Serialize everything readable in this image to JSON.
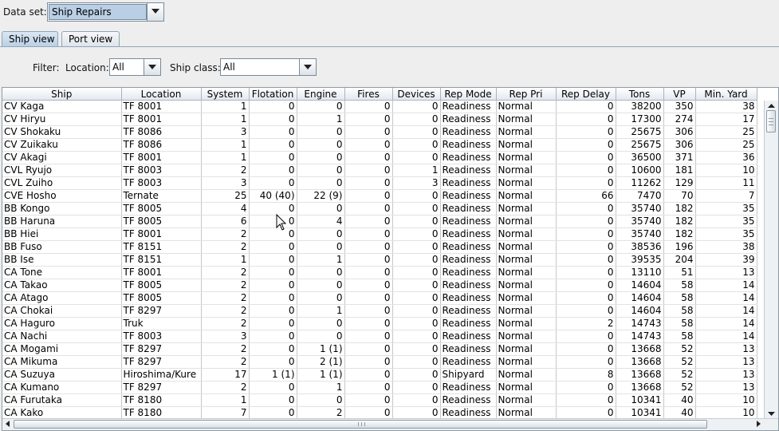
{
  "dataset": {
    "label": "Data set:",
    "value": "Ship Repairs"
  },
  "tabs": [
    {
      "label": "Ship view"
    },
    {
      "label": "Port view"
    }
  ],
  "filter": {
    "label": "Filter:",
    "location_label": "Location:",
    "location_value": "All",
    "shipclass_label": "Ship class:",
    "shipclass_value": "All"
  },
  "table": {
    "columns": [
      "Ship",
      "Location",
      "System",
      "Flotation",
      "Engine",
      "Fires",
      "Devices",
      "Rep Mode",
      "Rep Pri",
      "Rep Delay",
      "Tons",
      "VP",
      "Min. Yard"
    ],
    "rows": [
      [
        "CV Kaga",
        "TF 8001",
        "1",
        "0",
        "0",
        "0",
        "0",
        "Readiness",
        "Normal",
        "0",
        "38200",
        "350",
        "38"
      ],
      [
        "CV Hiryu",
        "TF 8001",
        "1",
        "0",
        "1",
        "0",
        "0",
        "Readiness",
        "Normal",
        "0",
        "17300",
        "274",
        "17"
      ],
      [
        "CV Shokaku",
        "TF 8086",
        "3",
        "0",
        "0",
        "0",
        "0",
        "Readiness",
        "Normal",
        "0",
        "25675",
        "306",
        "25"
      ],
      [
        "CV Zuikaku",
        "TF 8086",
        "1",
        "0",
        "0",
        "0",
        "0",
        "Readiness",
        "Normal",
        "0",
        "25675",
        "306",
        "25"
      ],
      [
        "CV Akagi",
        "TF 8001",
        "1",
        "0",
        "0",
        "0",
        "0",
        "Readiness",
        "Normal",
        "0",
        "36500",
        "371",
        "36"
      ],
      [
        "CVL Ryujo",
        "TF 8003",
        "2",
        "0",
        "0",
        "0",
        "1",
        "Readiness",
        "Normal",
        "0",
        "10600",
        "181",
        "10"
      ],
      [
        "CVL Zuiho",
        "TF 8003",
        "3",
        "0",
        "0",
        "0",
        "3",
        "Readiness",
        "Normal",
        "0",
        "11262",
        "129",
        "11"
      ],
      [
        "CVE Hosho",
        "Ternate",
        "25",
        "40 (40)",
        "22 (9)",
        "0",
        "0",
        "Readiness",
        "Normal",
        "66",
        "7470",
        "70",
        "7"
      ],
      [
        "BB Kongo",
        "TF 8005",
        "4",
        "0",
        "0",
        "0",
        "0",
        "Readiness",
        "Normal",
        "0",
        "35740",
        "182",
        "35"
      ],
      [
        "BB Haruna",
        "TF 8005",
        "6",
        "0",
        "4",
        "0",
        "0",
        "Readiness",
        "Normal",
        "0",
        "35740",
        "182",
        "35"
      ],
      [
        "BB Hiei",
        "TF 8001",
        "2",
        "0",
        "0",
        "0",
        "0",
        "Readiness",
        "Normal",
        "0",
        "35740",
        "182",
        "35"
      ],
      [
        "BB Fuso",
        "TF 8151",
        "2",
        "0",
        "0",
        "0",
        "0",
        "Readiness",
        "Normal",
        "0",
        "38536",
        "196",
        "38"
      ],
      [
        "BB Ise",
        "TF 8151",
        "1",
        "0",
        "1",
        "0",
        "0",
        "Readiness",
        "Normal",
        "0",
        "39535",
        "204",
        "39"
      ],
      [
        "CA Tone",
        "TF 8001",
        "2",
        "0",
        "0",
        "0",
        "0",
        "Readiness",
        "Normal",
        "0",
        "13110",
        "51",
        "13"
      ],
      [
        "CA Takao",
        "TF 8005",
        "2",
        "0",
        "0",
        "0",
        "0",
        "Readiness",
        "Normal",
        "0",
        "14604",
        "58",
        "14"
      ],
      [
        "CA Atago",
        "TF 8005",
        "2",
        "0",
        "0",
        "0",
        "0",
        "Readiness",
        "Normal",
        "0",
        "14604",
        "58",
        "14"
      ],
      [
        "CA Chokai",
        "TF 8297",
        "2",
        "0",
        "1",
        "0",
        "0",
        "Readiness",
        "Normal",
        "0",
        "14604",
        "58",
        "14"
      ],
      [
        "CA Haguro",
        "Truk",
        "2",
        "0",
        "0",
        "0",
        "0",
        "Readiness",
        "Normal",
        "2",
        "14743",
        "58",
        "14"
      ],
      [
        "CA Nachi",
        "TF 8003",
        "3",
        "0",
        "0",
        "0",
        "0",
        "Readiness",
        "Normal",
        "0",
        "14743",
        "58",
        "14"
      ],
      [
        "CA Mogami",
        "TF 8297",
        "2",
        "0",
        "1 (1)",
        "0",
        "0",
        "Readiness",
        "Normal",
        "0",
        "13668",
        "52",
        "13"
      ],
      [
        "CA Mikuma",
        "TF 8297",
        "2",
        "0",
        "2 (1)",
        "0",
        "0",
        "Readiness",
        "Normal",
        "0",
        "13668",
        "52",
        "13"
      ],
      [
        "CA Suzuya",
        "Hiroshima/Kure",
        "17",
        "1 (1)",
        "1 (1)",
        "0",
        "0",
        "Shipyard",
        "Normal",
        "8",
        "13668",
        "52",
        "13"
      ],
      [
        "CA Kumano",
        "TF 8297",
        "2",
        "0",
        "1",
        "0",
        "0",
        "Readiness",
        "Normal",
        "0",
        "13668",
        "52",
        "13"
      ],
      [
        "CA Furutaka",
        "TF 8180",
        "1",
        "0",
        "0",
        "0",
        "0",
        "Readiness",
        "Normal",
        "0",
        "10341",
        "40",
        "10"
      ],
      [
        "CA Kako",
        "TF 8180",
        "7",
        "0",
        "2",
        "0",
        "0",
        "Readiness",
        "Normal",
        "0",
        "10341",
        "40",
        "10"
      ]
    ]
  },
  "icons": {
    "dropdown": "chevron-down-icon",
    "scroll_up": "arrow-up-icon",
    "scroll_down": "arrow-down-icon",
    "scroll_left": "arrow-left-icon",
    "scroll_right": "arrow-right-icon",
    "cursor": "mouse-pointer-icon"
  },
  "colors": {
    "selection": "#b8cfe5",
    "header": "#e3e8ee",
    "border": "#8f9aa5"
  }
}
